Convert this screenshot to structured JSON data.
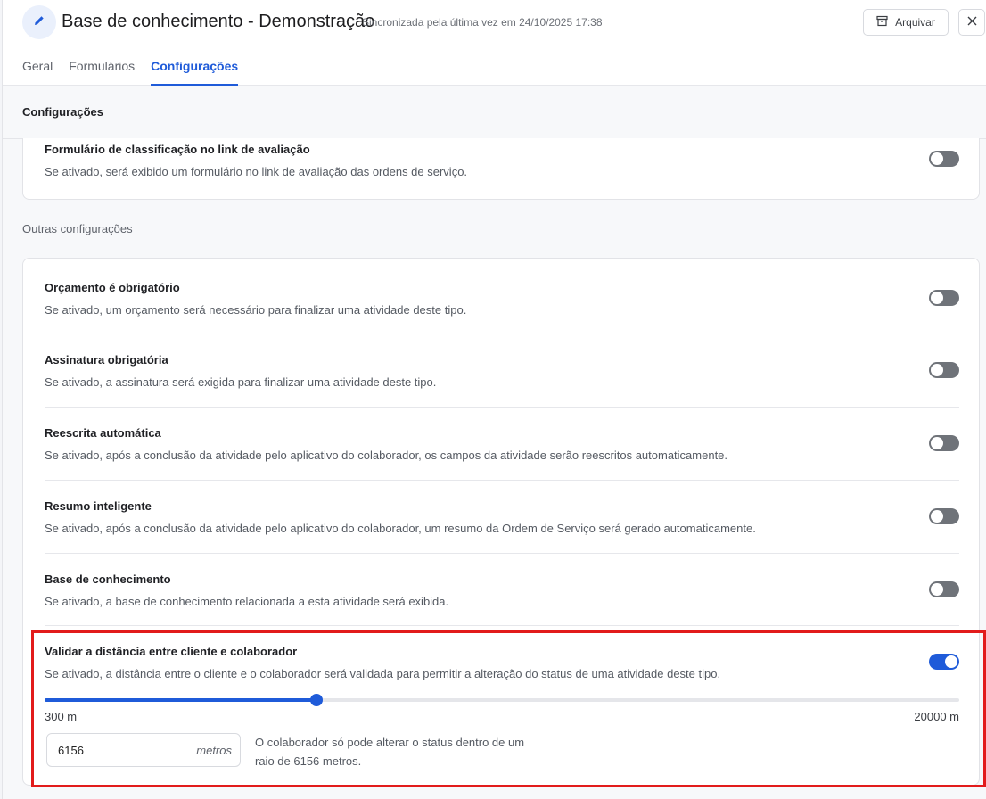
{
  "header": {
    "title": "Base de conhecimento - Demonstração",
    "sync_text": "Sincronizada pela última vez em 24/10/2025 17:38",
    "archive_label": "Arquivar"
  },
  "tabs": [
    {
      "label": "Geral",
      "active": false
    },
    {
      "label": "Formulários",
      "active": false
    },
    {
      "label": "Configurações",
      "active": true
    }
  ],
  "section_title": "Configurações",
  "rating_form": {
    "title": "Formulário de classificação no link de avaliação",
    "desc": "Se ativado, será exibido um formulário no link de avaliação das ordens de serviço.",
    "enabled": false
  },
  "other_title": "Outras configurações",
  "settings": [
    {
      "title": "Orçamento é obrigatório",
      "desc": "Se ativado, um orçamento será necessário para finalizar uma atividade deste tipo.",
      "enabled": false
    },
    {
      "title": "Assinatura obrigatória",
      "desc": "Se ativado, a assinatura será exigida para finalizar uma atividade deste tipo.",
      "enabled": false
    },
    {
      "title": "Reescrita automática",
      "desc": "Se ativado, após a conclusão da atividade pelo aplicativo do colaborador, os campos da atividade serão reescritos automaticamente.",
      "enabled": false
    },
    {
      "title": "Resumo inteligente",
      "desc": "Se ativado, após a conclusão da atividade pelo aplicativo do colaborador, um resumo da Ordem de Serviço será gerado automaticamente.",
      "enabled": false
    },
    {
      "title": "Base de conhecimento",
      "desc": "Se ativado, a base de conhecimento relacionada a esta atividade será exibida.",
      "enabled": false
    }
  ],
  "distance": {
    "title": "Validar a distância entre cliente e colaborador",
    "desc": "Se ativado, a distância entre o cliente e o colaborador será validada para permitir a alteração do status de uma atividade deste tipo.",
    "enabled": true,
    "min_label": "300 m",
    "max_label": "20000 m",
    "min": 300,
    "max": 20000,
    "value": 6156,
    "input_value": "6156",
    "unit": "metros",
    "help_text": "O colaborador só pode alterar o status dentro de um raio de 6156 metros."
  },
  "colors": {
    "accent": "#1f5bd9",
    "highlight": "#e21b1b",
    "toggle_off": "#6f7379"
  }
}
